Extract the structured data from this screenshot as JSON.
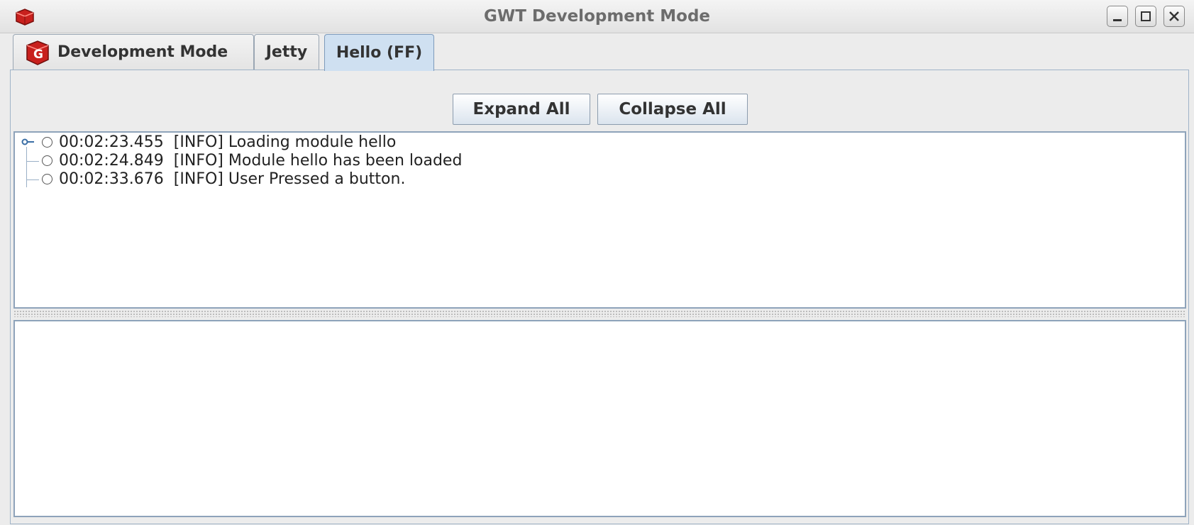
{
  "window": {
    "title": "GWT Development Mode",
    "app_icon": "gwt-toolbox-icon",
    "controls": [
      "minimize-icon",
      "maximize-icon",
      "close-icon"
    ]
  },
  "tabs": [
    {
      "label": "Development Mode",
      "icon": "gwt-logo-icon",
      "active": false
    },
    {
      "label": "Jetty",
      "active": false
    },
    {
      "label": "Hello (FF)",
      "active": true
    }
  ],
  "toolbar": {
    "expand_label": "Expand All",
    "collapse_label": "Collapse All"
  },
  "log": {
    "entries": [
      {
        "time": "00:02:23.455",
        "level": "[INFO]",
        "message": "Loading module hello"
      },
      {
        "time": "00:02:24.849",
        "level": "[INFO]",
        "message": "Module hello has been loaded"
      },
      {
        "time": "00:02:33.676",
        "level": "[INFO]",
        "message": "User Pressed a button."
      }
    ]
  },
  "details": {
    "text": ""
  },
  "colors": {
    "active_tab": "#cfe0f1",
    "border": "#8ea3ba",
    "tab_icon_red": "#c8201d"
  }
}
